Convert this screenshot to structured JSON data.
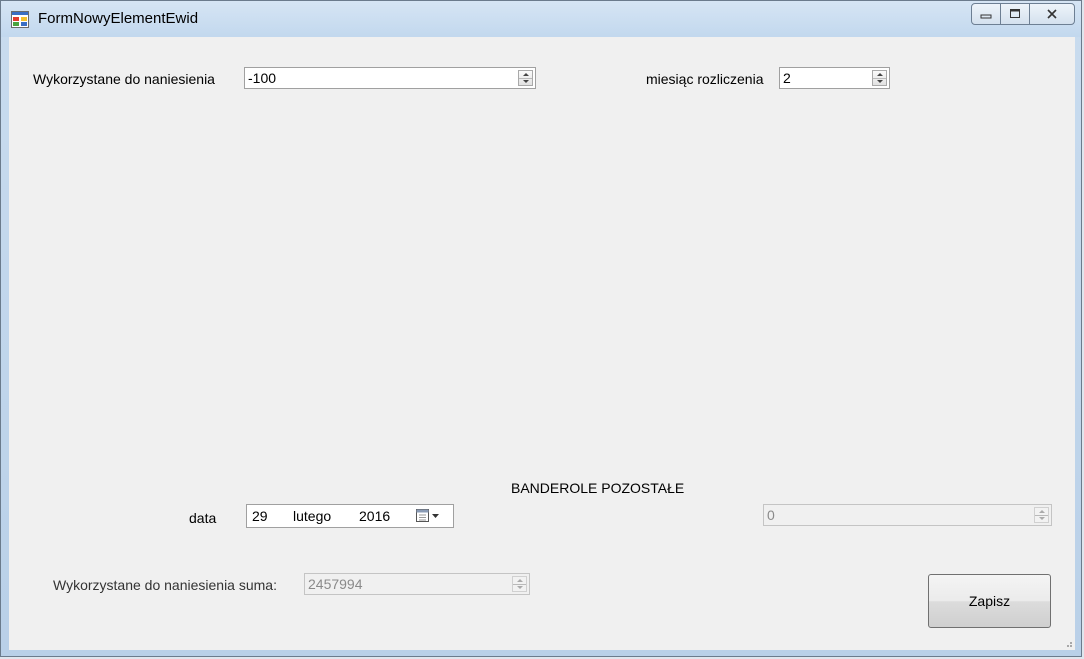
{
  "window": {
    "title": "FormNowyElementEwid"
  },
  "form": {
    "wykorzystane_label": "Wykorzystane do naniesienia",
    "wykorzystane_value": "-100",
    "miesiac_label": "miesiąc rozliczenia",
    "miesiac_value": "2",
    "banderole_label": "BANDEROLE POZOSTAŁE",
    "banderole_value": "0",
    "data_label": "data",
    "date": {
      "day": "29",
      "month": "lutego",
      "year": "2016"
    },
    "suma_label": "Wykorzystane do naniesienia suma:",
    "suma_value": "2457994",
    "save_label": "Zapisz"
  },
  "icons": {
    "app": "form-window-icon",
    "minimize": "minimize-icon",
    "maximize": "maximize-icon",
    "close": "close-icon",
    "calendar": "calendar-dropdown-icon",
    "spinner_up": "spinner-up-icon",
    "spinner_down": "spinner-down-icon"
  },
  "colors": {
    "client_bg": "#f0f0f0",
    "titlebar": "#c2d8ee",
    "disabled_text": "#8a8a8a"
  }
}
